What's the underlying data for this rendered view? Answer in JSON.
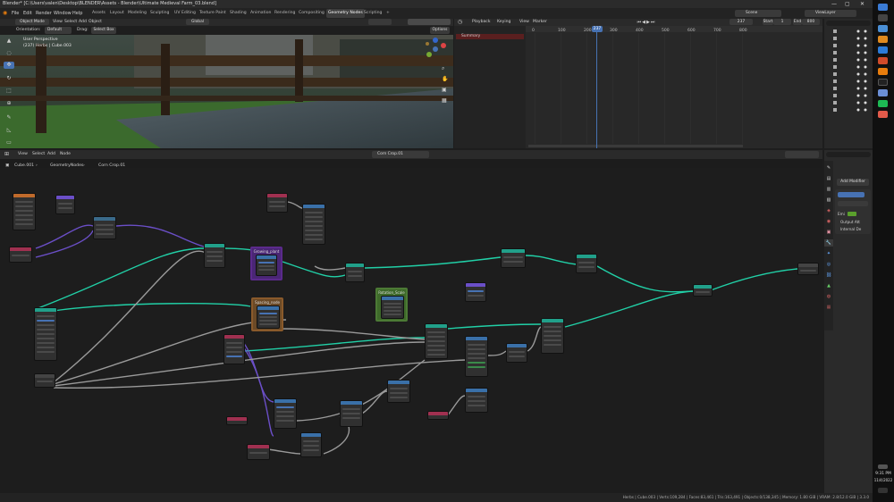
{
  "window": {
    "title": "Blender* [C:\\Users\\valen\\Desktop\\BLENDER\\Assets - Blender\\Ultimate Medieval Farm_03.blend]",
    "min": "—",
    "max": "▢",
    "close": "✕"
  },
  "menu": [
    "File",
    "Edit",
    "Render",
    "Window",
    "Help"
  ],
  "workspaces": [
    "Assets",
    "Layout",
    "Modeling",
    "Sculpting",
    "UV Editing",
    "Texture Paint",
    "Shading",
    "Animation",
    "Rendering",
    "Compositing",
    "Geometry Nodes",
    "Scripting",
    "+"
  ],
  "active_workspace": "Geometry Nodes",
  "scene": {
    "label": "Scene",
    "viewlayer": "ViewLayer"
  },
  "viewport": {
    "mode": "Object Mode",
    "menus": [
      "View",
      "Select",
      "Add",
      "Object"
    ],
    "transform": "Global",
    "orientation_label": "Orientation:",
    "orientation_value": "Default",
    "drag_label": "Drag:",
    "drag_value": "Select Box",
    "options": "Options",
    "info_line1": "User Perspective",
    "info_line2": "(237) Herbs | Cube.003"
  },
  "timeline": {
    "menus": [
      "Playback",
      "Keying",
      "View",
      "Marker"
    ],
    "frame": "237",
    "start_label": "Start",
    "start": "1",
    "end_label": "End",
    "end": "800",
    "summary": "Summary",
    "ticks": [
      "0",
      "100",
      "200",
      "300",
      "400",
      "500",
      "600",
      "700",
      "800"
    ],
    "playhead": 237
  },
  "node_editor": {
    "menus": [
      "View",
      "Select",
      "Add",
      "Node"
    ],
    "tree_name": "Corn Crop.01",
    "breadcrumb": [
      "Cube.001",
      "GeometryNodes",
      "Corn Crop.01"
    ],
    "frames": [
      "Growing_plant",
      "Spacing_node",
      "Rotation_Scale"
    ]
  },
  "properties": {
    "add_modifier": "Add Modifier",
    "items": [
      "Output Att",
      "Internal De"
    ],
    "field_label": "Emi"
  },
  "statusbar": {
    "text": "Herbs | Cube.003 | Verts:109,284 | Faces:83,461 | Tris:163,491 | Objects:0/138,345 | Memory: 1.80 GiB | VRAM: 2.8/12.0 GiB | 3.3.0"
  },
  "taskbar": {
    "time": "9:31 PM",
    "date": "11/4/2022"
  },
  "colors": {
    "accent": "#4772b3",
    "link_green": "#21d0a7",
    "link_purple": "#6b4fc8",
    "link_gray": "#9a9a9a",
    "frame_purple": "#5b2a8c",
    "frame_orange": "#8a5a2b",
    "frame_green": "#4c7a35",
    "playhead": "#4772b3"
  }
}
